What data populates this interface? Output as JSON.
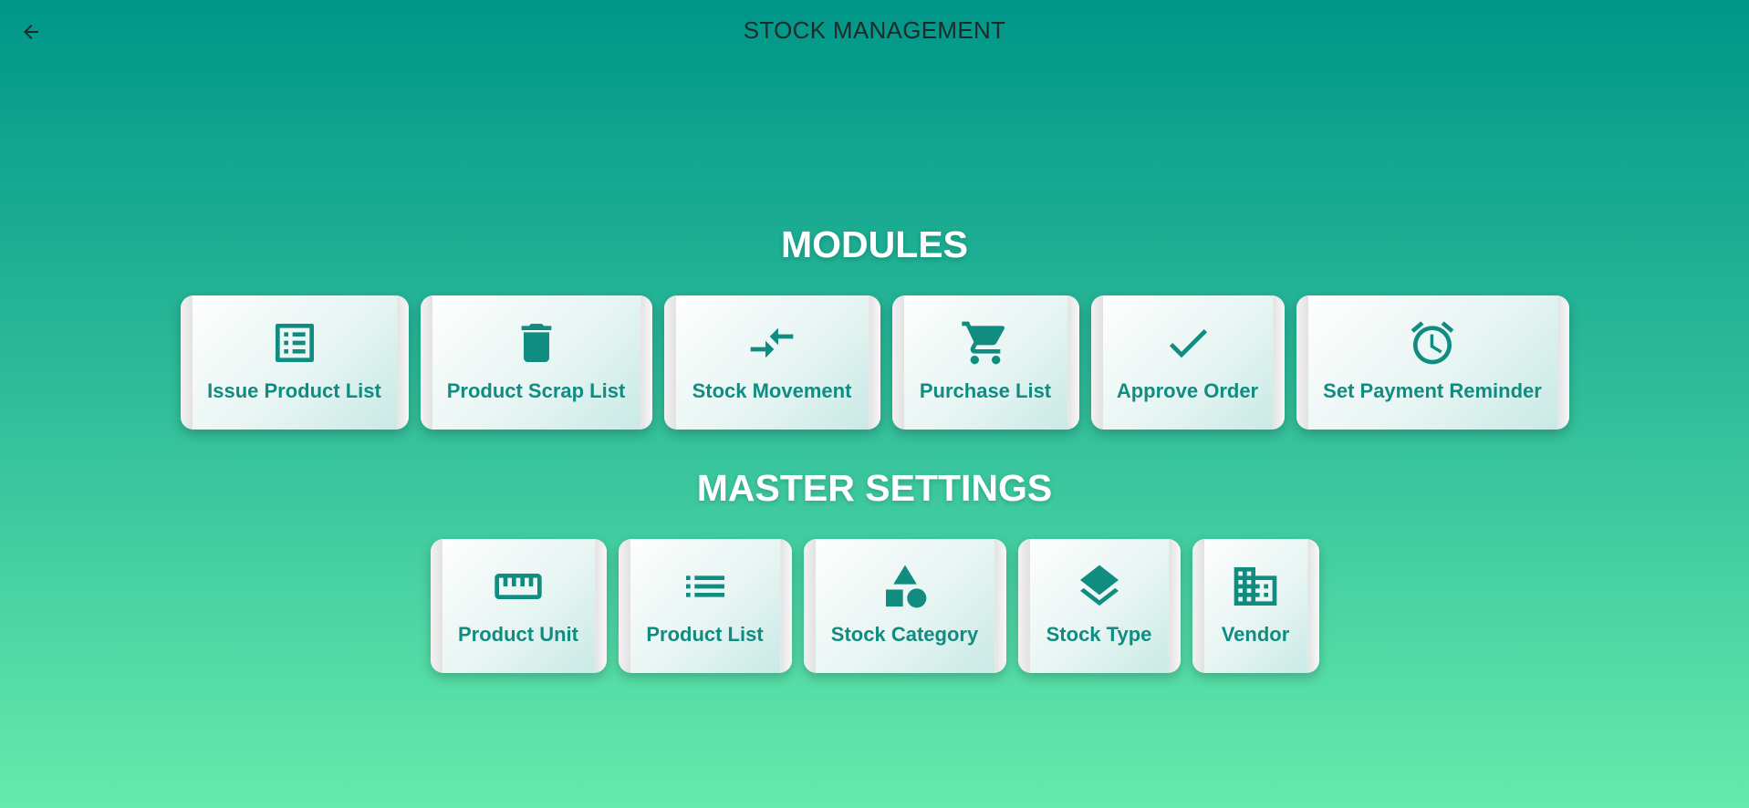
{
  "header": {
    "title": "STOCK MANAGEMENT",
    "back_icon": "arrow-back-icon"
  },
  "colors": {
    "accent": "#009688",
    "label": "#118c80",
    "gradient_top": "#009688",
    "gradient_bottom": "#66ebad"
  },
  "modules": {
    "title": "MODULES",
    "items": [
      {
        "label": "Issue Product List",
        "icon": "list-alt-icon"
      },
      {
        "label": "Product Scrap List",
        "icon": "trash-icon"
      },
      {
        "label": "Stock Movement",
        "icon": "compare-arrows-icon"
      },
      {
        "label": "Purchase List",
        "icon": "cart-icon"
      },
      {
        "label": "Approve Order",
        "icon": "check-icon"
      },
      {
        "label": "Set Payment Reminder",
        "icon": "alarm-icon"
      }
    ]
  },
  "master_settings": {
    "title": "MASTER SETTINGS",
    "items": [
      {
        "label": "Product Unit",
        "icon": "ruler-icon"
      },
      {
        "label": "Product List",
        "icon": "list-icon"
      },
      {
        "label": "Stock Category",
        "icon": "category-shapes-icon"
      },
      {
        "label": "Stock Type",
        "icon": "layers-icon"
      },
      {
        "label": "Vendor",
        "icon": "building-icon"
      }
    ]
  }
}
